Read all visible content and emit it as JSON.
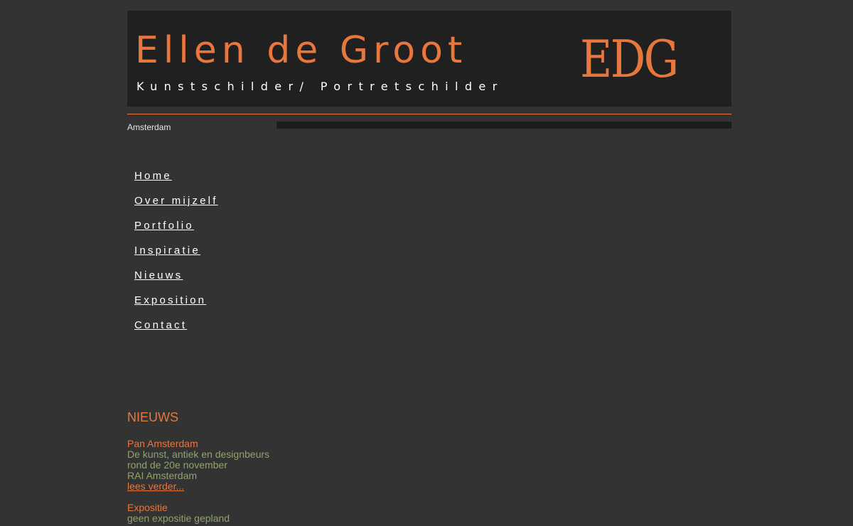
{
  "header": {
    "title": "Ellen de Groot",
    "subtitle": "Kunstschilder/ Portretschilder",
    "logo": "EDG"
  },
  "location": "Amsterdam",
  "nav": [
    {
      "label": "Home"
    },
    {
      "label": "Over mijzelf"
    },
    {
      "label": "Portfolio"
    },
    {
      "label": "Inspiratie"
    },
    {
      "label": "Nieuws"
    },
    {
      "label": "Exposition"
    },
    {
      "label": "Contact"
    }
  ],
  "news": {
    "heading": "NIEUWS",
    "items": [
      {
        "title": "Pan Amsterdam",
        "lines": [
          "De kunst, antiek en designbeurs",
          "rond de 20e november",
          "RAI Amsterdam"
        ],
        "link": "lees verder..."
      },
      {
        "title": "Expositie",
        "lines": [
          "geen expositie gepland"
        ]
      }
    ]
  },
  "colors": {
    "background": "#333333",
    "header_background": "#202020",
    "accent": "#e8773d",
    "news_text": "#8fa46a",
    "nav_text": "#ffffff"
  }
}
